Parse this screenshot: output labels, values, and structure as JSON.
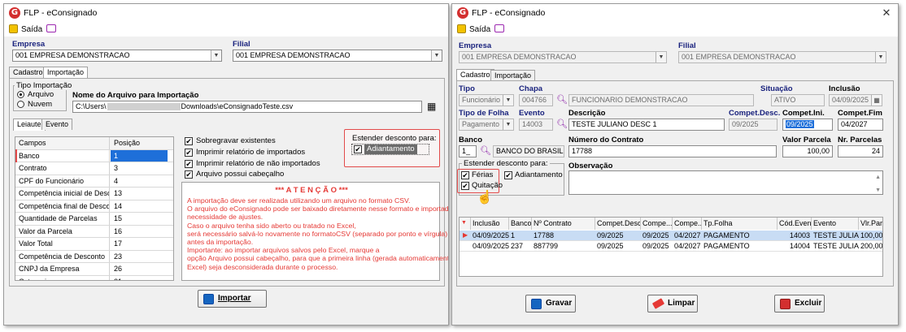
{
  "left_window": {
    "title": "FLP - eConsignado",
    "toolbar": {
      "exit_label": "Saída"
    },
    "empresa_label": "Empresa",
    "empresa_value": "001 EMPRESA DEMONSTRACAO",
    "filial_label": "Filial",
    "filial_value": "001 EMPRESA DEMONSTRACAO",
    "tabs": [
      "Cadastro",
      "Importação"
    ],
    "tipo_importacao": {
      "label": "Tipo Importação",
      "options": [
        "Arquivo",
        "Nuvem"
      ],
      "selected": "Arquivo"
    },
    "arquivo_label": "Nome do Arquivo para Importação",
    "arquivo_prefix": "C:\\Users\\",
    "arquivo_suffix": "Downloads\\eConsignadoTeste.csv",
    "sub_tabs": [
      "Leiaute",
      "Evento"
    ],
    "grid": {
      "headers": [
        "Campos",
        "Posição"
      ],
      "rows": [
        [
          "Banco",
          "1"
        ],
        [
          "Contrato",
          "3"
        ],
        [
          "CPF do Funcionário",
          "4"
        ],
        [
          "Competência inicial de Desconto",
          "13"
        ],
        [
          "Competência final de Desconto",
          "14"
        ],
        [
          "Quantidade de Parcelas",
          "15"
        ],
        [
          "Valor da Parcela",
          "16"
        ],
        [
          "Valor Total",
          "17"
        ],
        [
          "Competência de Desconto",
          "23"
        ],
        [
          "CNPJ da Empresa",
          "26"
        ],
        [
          "Categoria",
          "21"
        ]
      ]
    },
    "options": [
      {
        "label": "Sobregravar existentes",
        "checked": true
      },
      {
        "label": "Imprimir relatório de importados",
        "checked": true
      },
      {
        "label": "Imprimir relatório de não importados",
        "checked": true
      },
      {
        "label": "Arquivo possui cabeçalho",
        "checked": true
      }
    ],
    "estender": {
      "label": "Estender desconto para:",
      "option": "Adiantamento",
      "checked": true
    },
    "atencao": {
      "title": "*** A T E N Ç Ã O ***",
      "lines": [
        "A importação deve ser realizada utilizando um arquivo no formato CSV.",
        "O arquivo do eConsignado pode ser baixado diretamente nesse formato e importado sem",
        "necessidade de ajustes.",
        "Caso o arquivo tenha sido aberto ou tratado no Excel,",
        "será necessário salvá-lo novamente no formatoCSV (separado por ponto e vírgula)",
        "antes da importação.",
        "Importante: ao importar arquivos salvos pelo Excel, marque a",
        "opção Arquivo possui cabeçalho, para que a primeira linha (gerada automaticamente pelo",
        "Excel) seja desconsiderada durante o processo."
      ]
    },
    "importar_label": "Importar"
  },
  "right_window": {
    "title": "FLP - eConsignado",
    "toolbar": {
      "exit_label": "Saída"
    },
    "empresa_label": "Empresa",
    "empresa_value": "001 EMPRESA DEMONSTRACAO",
    "filial_label": "Filial",
    "filial_value": "001 EMPRESA DEMONSTRACAO",
    "tabs": [
      "Cadastro",
      "Importação"
    ],
    "tipo": {
      "label": "Tipo",
      "value": "Funcionário"
    },
    "chapa": {
      "label": "Chapa",
      "value": "004766",
      "name": "FUNCIONARIO DEMONSTRACAO"
    },
    "situacao": {
      "label": "Situação",
      "value": "ATIVO"
    },
    "inclusao": {
      "label": "Inclusão",
      "value": "04/09/2025"
    },
    "tipo_folha": {
      "label": "Tipo de Folha",
      "value": "Pagamento"
    },
    "evento": {
      "label": "Evento",
      "value": "14003"
    },
    "descricao": {
      "label": "Descrição",
      "value": "TESTE JULIANO DESC 1"
    },
    "compet_desc": {
      "label": "Compet.Desc.",
      "value": "09/2025"
    },
    "compet_ini": {
      "label": "Compet.Ini.",
      "value": "09/2025"
    },
    "compet_fim": {
      "label": "Compet.Fim",
      "value": "04/2027"
    },
    "banco": {
      "label": "Banco",
      "code": "1_",
      "name": "BANCO DO BRASIL"
    },
    "contrato": {
      "label": "Número do Contrato",
      "value": "17788"
    },
    "valor_parcela": {
      "label": "Valor Parcela",
      "value": "100,00"
    },
    "nr_parcelas": {
      "label": "Nr. Parcelas",
      "value": "24"
    },
    "estender": {
      "label": "Estender desconto para:",
      "ferias": "Férias",
      "adiantamento": "Adiantamento",
      "quitacao": "Quitação"
    },
    "observacao_label": "Observação",
    "table": {
      "headers": [
        "Inclusão",
        "Banco",
        "Nº Contrato",
        "Compet.Desc.",
        "Compe...",
        "Compe...",
        "Tp.Folha",
        "Cód.Even.",
        "Evento",
        "Vlr.Par"
      ],
      "rows": [
        [
          "04/09/2025",
          "1",
          "17788",
          "09/2025",
          "09/2025",
          "04/2027",
          "PAGAMENTO",
          "14003",
          "TESTE JULIA...",
          "100,00"
        ],
        [
          "04/09/2025",
          "237",
          "887799",
          "09/2025",
          "09/2025",
          "04/2027",
          "PAGAMENTO",
          "14004",
          "TESTE JULIA...",
          "200,00"
        ]
      ]
    },
    "buttons": {
      "gravar": "Gravar",
      "limpar": "Limpar",
      "excluir": "Excluir"
    }
  },
  "colors": {
    "accent_red": "#e24a4a",
    "selection_blue": "#1e6fd9",
    "label_blue": "#1a237e",
    "warning_red": "#e53935"
  }
}
